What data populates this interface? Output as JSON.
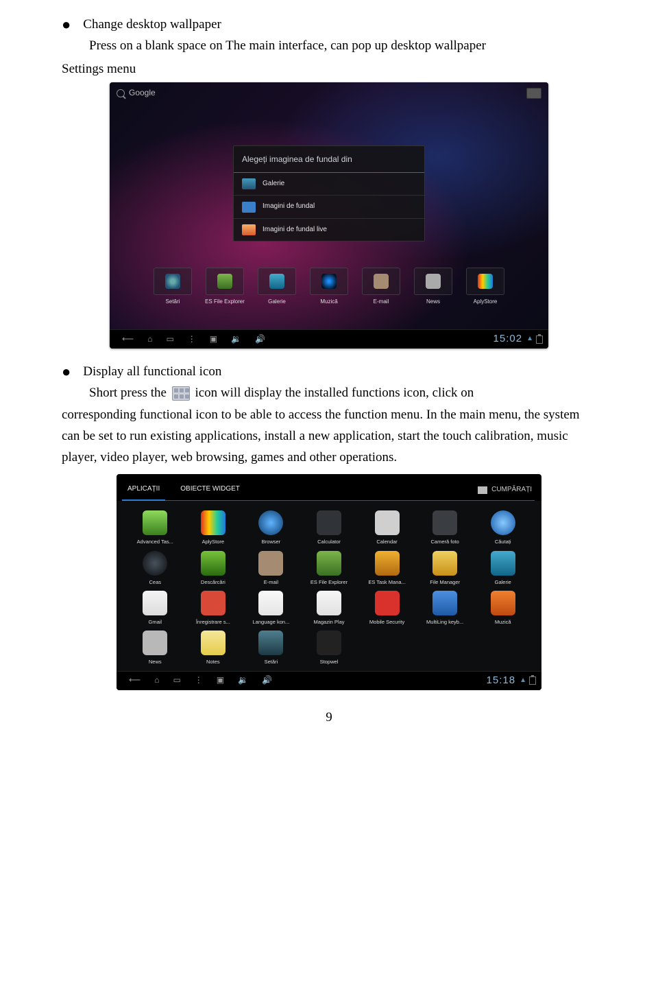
{
  "doc": {
    "heading1": "Change desktop wallpaper",
    "heading1_desc": "Press on a blank space on The main interface, can pop up desktop wallpaper",
    "settings_menu": "Settings menu",
    "heading2": "Display all functional icon",
    "line_pre": "Short press the",
    "line_post": "icon will display the installed functions icon, click on",
    "para": "corresponding functional icon to be able to access the function menu. In the main menu, the system can be set to run existing applications, install a new application, start the touch calibration, music player, video player, web browsing, games and other operations.",
    "page_number": "9"
  },
  "tablet1": {
    "search_label": "Google",
    "dialog_title": "Alegeți imaginea de fundal din",
    "dialog_items": [
      "Galerie",
      "Imagini de fundal",
      "Imagini de fundal live"
    ],
    "dock": [
      "Setări",
      "ES File Explorer",
      "Galerie",
      "Muzică",
      "E-mail",
      "News",
      "AplyStore"
    ],
    "time": "15:02"
  },
  "tablet2": {
    "tabs": [
      "APLICAȚII",
      "OBIECTE WIDGET"
    ],
    "shop": "CUMPĂRAȚI",
    "apps": [
      {
        "label": "Advanced Tas...",
        "bg": "linear-gradient(#8fd95c,#3a7f1d)"
      },
      {
        "label": "AplyStore",
        "bg": "linear-gradient(90deg,#d32,#fc0,#2c9,#27d)"
      },
      {
        "label": "Browser",
        "bg": "radial-gradient(#5fb4ff,#0b3a6a)",
        "round": true
      },
      {
        "label": "Calculator",
        "bg": "#303338"
      },
      {
        "label": "Calendar",
        "bg": "#cfcfcf"
      },
      {
        "label": "Cameră foto",
        "bg": "#3a3d42"
      },
      {
        "label": "Căutați",
        "bg": "radial-gradient(#88c9ff,#1256a6)",
        "round": true
      },
      {
        "label": "Ceas",
        "bg": "radial-gradient(#48525c,#0b0d10)",
        "round": true
      },
      {
        "label": "Descărcări",
        "bg": "linear-gradient(#78c23a,#2a6b10)"
      },
      {
        "label": "E-mail",
        "bg": "#a58b72"
      },
      {
        "label": "ES File Explorer",
        "bg": "linear-gradient(#7db54b,#3a6f22)"
      },
      {
        "label": "ES Task Mana...",
        "bg": "linear-gradient(#f0b030,#b06a10)"
      },
      {
        "label": "File Manager",
        "bg": "linear-gradient(#f0d060,#c79118)"
      },
      {
        "label": "Galerie",
        "bg": "linear-gradient(#4ac,#168)"
      },
      {
        "label": "Gmail",
        "bg": "linear-gradient(#f4f4f4,#dcdcdc)"
      },
      {
        "label": "Înregistrare s...",
        "bg": "#d84a37"
      },
      {
        "label": "Language kon...",
        "bg": "linear-gradient(#f9f9f9,#e4e4e4)"
      },
      {
        "label": "Magazin Play",
        "bg": "linear-gradient(#f6f6f6,#e0e0e0)"
      },
      {
        "label": "Mobile Security",
        "bg": "#d9322c"
      },
      {
        "label": "MultiLing keyb...",
        "bg": "linear-gradient(#4c8fe0,#1e5aa6)"
      },
      {
        "label": "Muzică",
        "bg": "linear-gradient(#f08030,#c04a10)"
      },
      {
        "label": "News",
        "bg": "#b8b8b8"
      },
      {
        "label": "Notes",
        "bg": "linear-gradient(#f6e699,#e4cc4a)"
      },
      {
        "label": "Setări",
        "bg": "linear-gradient(#4f7f8f,#1d3a44)"
      },
      {
        "label": "Stopwel",
        "bg": "#222"
      }
    ],
    "time": "15:18"
  }
}
